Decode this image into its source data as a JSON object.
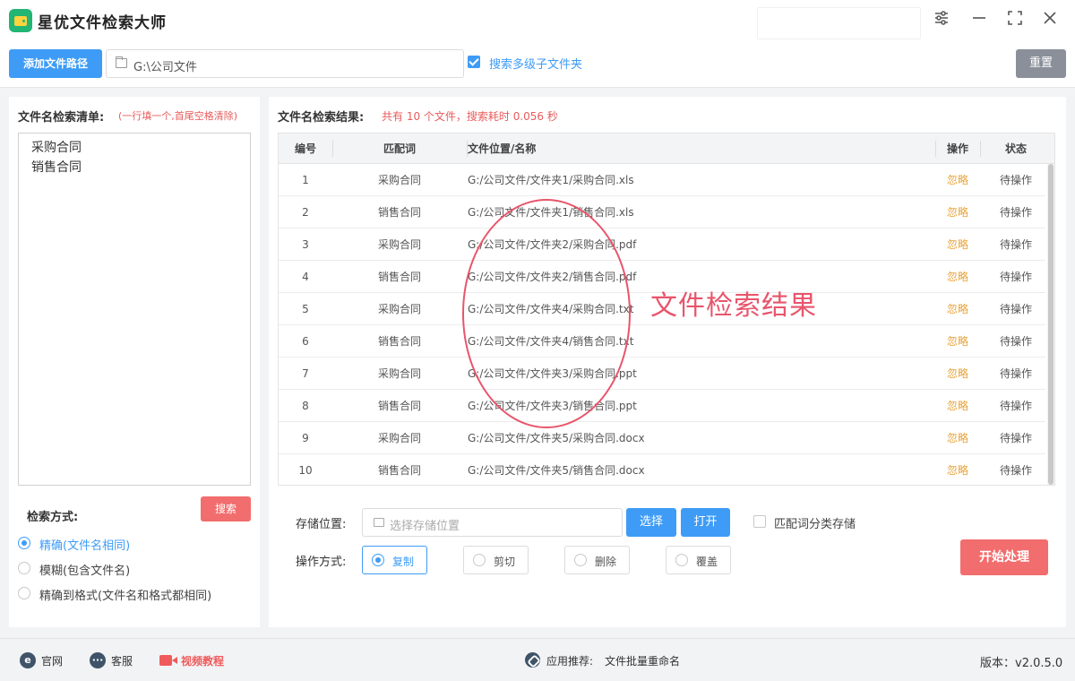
{
  "app": {
    "title": "星优文件检索大师"
  },
  "toolbar": {
    "add_path_label": "添加文件路径",
    "path_value": "G:\\公司文件",
    "subfolder_label": "搜索多级子文件夹",
    "subfolder_checked": true,
    "reset_label": "重置"
  },
  "left": {
    "title": "文件名检索清单:",
    "hint": "(一行填一个,首尾空格清除)",
    "names_text": "采购合同\n销售合同",
    "search_label": "搜索",
    "mode_title": "检索方式:",
    "modes": [
      {
        "label": "精确(文件名相同)",
        "selected": true
      },
      {
        "label": "模糊(包含文件名)",
        "selected": false
      },
      {
        "label": "精确到格式(文件名和格式都相同)",
        "selected": false
      }
    ]
  },
  "results": {
    "title": "文件名检索结果:",
    "summary": "共有 10 个文件，搜索耗时 0.056 秒",
    "columns": {
      "idx": "编号",
      "keyword": "匹配词",
      "path": "文件位置/名称",
      "op": "操作",
      "status": "状态"
    },
    "rows": [
      {
        "idx": "1",
        "keyword": "采购合同",
        "path": "G:/公司文件/文件夹1/采购合同.xls",
        "op": "忽略",
        "status": "待操作"
      },
      {
        "idx": "2",
        "keyword": "销售合同",
        "path": "G:/公司文件/文件夹1/销售合同.xls",
        "op": "忽略",
        "status": "待操作"
      },
      {
        "idx": "3",
        "keyword": "采购合同",
        "path": "G:/公司文件/文件夹2/采购合同.pdf",
        "op": "忽略",
        "status": "待操作"
      },
      {
        "idx": "4",
        "keyword": "销售合同",
        "path": "G:/公司文件/文件夹2/销售合同.pdf",
        "op": "忽略",
        "status": "待操作"
      },
      {
        "idx": "5",
        "keyword": "采购合同",
        "path": "G:/公司文件/文件夹4/采购合同.txt",
        "op": "忽略",
        "status": "待操作"
      },
      {
        "idx": "6",
        "keyword": "销售合同",
        "path": "G:/公司文件/文件夹4/销售合同.txt",
        "op": "忽略",
        "status": "待操作"
      },
      {
        "idx": "7",
        "keyword": "采购合同",
        "path": "G:/公司文件/文件夹3/采购合同.ppt",
        "op": "忽略",
        "status": "待操作"
      },
      {
        "idx": "8",
        "keyword": "销售合同",
        "path": "G:/公司文件/文件夹3/销售合同.ppt",
        "op": "忽略",
        "status": "待操作"
      },
      {
        "idx": "9",
        "keyword": "采购合同",
        "path": "G:/公司文件/文件夹5/采购合同.docx",
        "op": "忽略",
        "status": "待操作"
      },
      {
        "idx": "10",
        "keyword": "销售合同",
        "path": "G:/公司文件/文件夹5/销售合同.docx",
        "op": "忽略",
        "status": "待操作"
      }
    ],
    "annotation": "文件检索结果"
  },
  "storage": {
    "label": "存储位置:",
    "placeholder": "选择存储位置",
    "choose_label": "选择",
    "open_label": "打开",
    "classify_label": "匹配词分类存储",
    "classify_checked": false
  },
  "operation": {
    "label": "操作方式:",
    "options": [
      {
        "label": "复制",
        "selected": true
      },
      {
        "label": "剪切",
        "selected": false
      },
      {
        "label": "删除",
        "selected": false
      },
      {
        "label": "覆盖",
        "selected": false
      }
    ],
    "start_label": "开始处理"
  },
  "footer": {
    "website": "官网",
    "service": "客服",
    "video": "视频教程",
    "recommend_prefix": "应用推荐:",
    "recommend_app": "文件批量重命名",
    "version": "版本：v2.0.5.0"
  },
  "colors": {
    "accent": "#3e9cf6",
    "danger": "#f26d6d",
    "warning": "#e8a33a"
  },
  "icons": [
    "app-logo-icon",
    "settings-icon",
    "minimize-icon",
    "maximize-icon",
    "close-icon",
    "folder-icon",
    "ie-icon",
    "chat-icon",
    "video-icon",
    "link-icon"
  ]
}
